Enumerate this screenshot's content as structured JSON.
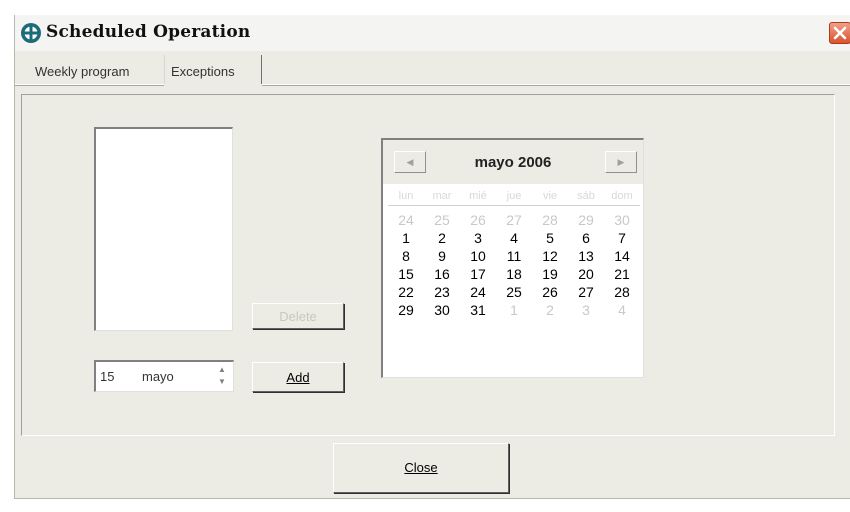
{
  "window": {
    "title": "Scheduled Operation",
    "icon": "app-globe-icon",
    "close_icon": "close-x-icon",
    "accent_color": "#d8542e"
  },
  "tabs": [
    {
      "label": "Weekly program"
    },
    {
      "label": "Exceptions",
      "selected": true
    }
  ],
  "buttons": {
    "delete_label": "Delete",
    "add_label": "Add",
    "close_label": "Close"
  },
  "date_picker": {
    "day": "15",
    "month": "mayo"
  },
  "calendar": {
    "title": "mayo 2006",
    "weekdays": [
      "lun",
      "mar",
      "mié",
      "jue",
      "vie",
      "sáb",
      "dom"
    ],
    "weeks": [
      [
        {
          "d": "24",
          "muted": true
        },
        {
          "d": "25",
          "muted": true
        },
        {
          "d": "26",
          "muted": true
        },
        {
          "d": "27",
          "muted": true
        },
        {
          "d": "28",
          "muted": true
        },
        {
          "d": "29",
          "muted": true
        },
        {
          "d": "30",
          "muted": true
        }
      ],
      [
        {
          "d": "1"
        },
        {
          "d": "2"
        },
        {
          "d": "3"
        },
        {
          "d": "4"
        },
        {
          "d": "5"
        },
        {
          "d": "6"
        },
        {
          "d": "7"
        }
      ],
      [
        {
          "d": "8"
        },
        {
          "d": "9"
        },
        {
          "d": "10"
        },
        {
          "d": "11"
        },
        {
          "d": "12"
        },
        {
          "d": "13"
        },
        {
          "d": "14"
        }
      ],
      [
        {
          "d": "15"
        },
        {
          "d": "16"
        },
        {
          "d": "17"
        },
        {
          "d": "18"
        },
        {
          "d": "19"
        },
        {
          "d": "20"
        },
        {
          "d": "21"
        }
      ],
      [
        {
          "d": "22"
        },
        {
          "d": "23"
        },
        {
          "d": "24"
        },
        {
          "d": "25"
        },
        {
          "d": "26"
        },
        {
          "d": "27"
        },
        {
          "d": "28"
        }
      ],
      [
        {
          "d": "29"
        },
        {
          "d": "30"
        },
        {
          "d": "31"
        },
        {
          "d": "1",
          "muted": true
        },
        {
          "d": "2",
          "muted": true
        },
        {
          "d": "3",
          "muted": true
        },
        {
          "d": "4",
          "muted": true
        }
      ]
    ]
  }
}
